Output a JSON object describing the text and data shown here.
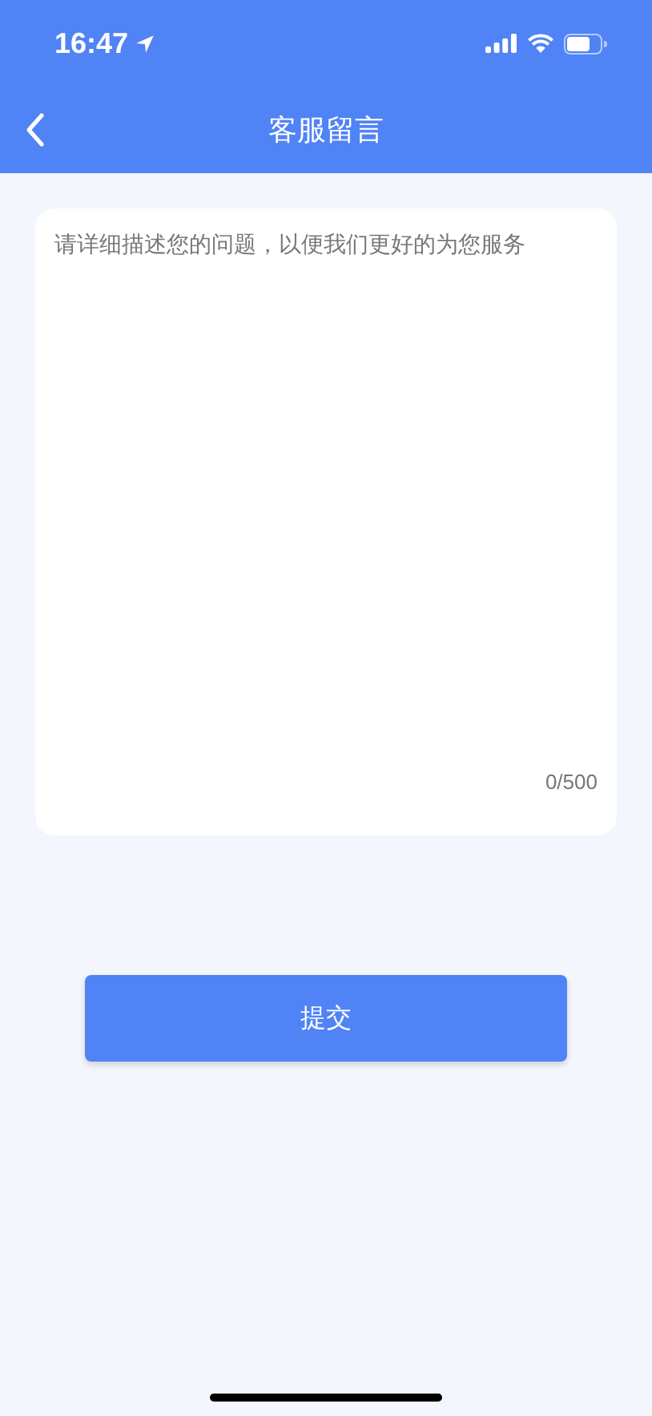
{
  "status_bar": {
    "time": "16:47"
  },
  "nav": {
    "title": "客服留言"
  },
  "message": {
    "placeholder": "请详细描述您的问题，以便我们更好的为您服务",
    "counter": "0/500"
  },
  "submit": {
    "label": "提交"
  }
}
